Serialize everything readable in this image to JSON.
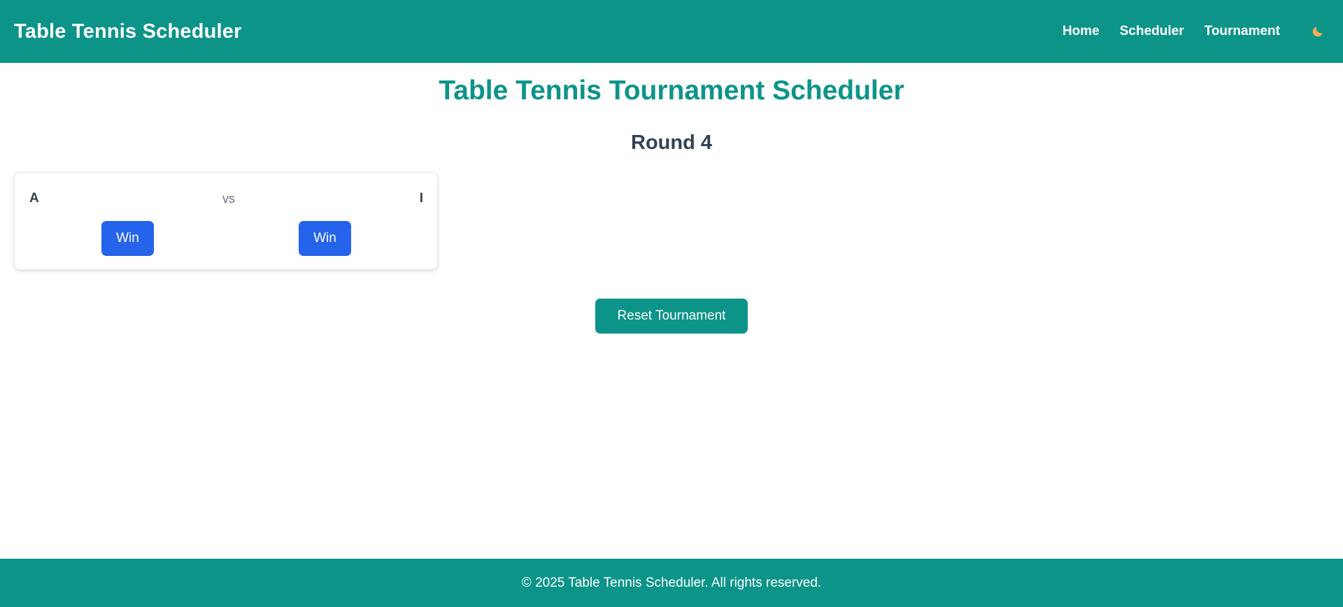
{
  "header": {
    "brand": "Table Tennis Scheduler",
    "nav": [
      {
        "label": "Home"
      },
      {
        "label": "Scheduler"
      },
      {
        "label": "Tournament"
      }
    ],
    "theme_toggle_icon": "moon-icon"
  },
  "main": {
    "title": "Table Tennis Tournament Scheduler",
    "round_title": "Round 4",
    "match": {
      "player_a": "A",
      "separator": "vs",
      "player_b": "I",
      "win_a_label": "Win",
      "win_b_label": "Win"
    },
    "reset_label": "Reset Tournament"
  },
  "footer": {
    "text": "© 2025 Table Tennis Scheduler. All rights reserved."
  },
  "colors": {
    "primary": "#0d9488",
    "button_blue": "#2563eb",
    "text_dark": "#334155",
    "text_muted": "#6b7280",
    "moon": "#f6ad55"
  }
}
